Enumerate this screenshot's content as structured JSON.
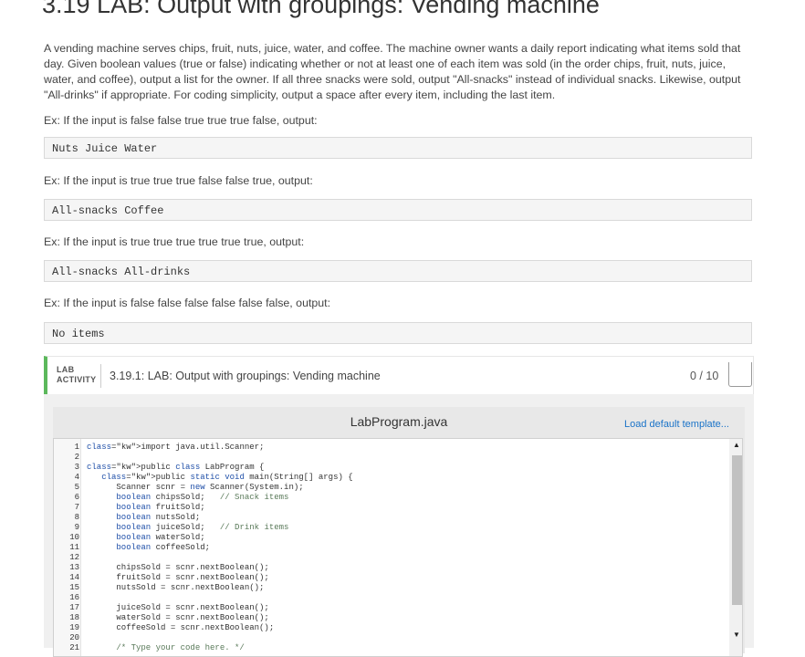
{
  "page": {
    "title": "3.19 LAB: Output with groupings: Vending machine",
    "description": "A vending machine serves chips, fruit, nuts, juice, water, and coffee. The machine owner wants a daily report indicating what items sold that day. Given boolean values (true or false) indicating whether or not at least one of each item was sold (in the order chips, fruit, nuts, juice, water, and coffee), output a list for the owner. If all three snacks were sold, output \"All-snacks\" instead of individual snacks. Likewise, output \"All-drinks\" if appropriate. For coding simplicity, output a space after every item, including the last item."
  },
  "examples": [
    {
      "label": "Ex: If the input is false false true true true false, output:",
      "output": "Nuts Juice Water"
    },
    {
      "label": "Ex: If the input is true true true false false true, output:",
      "output": "All-snacks Coffee"
    },
    {
      "label": "Ex: If the input is true true true true true true, output:",
      "output": "All-snacks All-drinks"
    },
    {
      "label": "Ex: If the input is false false false false false false, output:",
      "output": "No items"
    }
  ],
  "lab": {
    "tag_line1": "LAB",
    "tag_line2": "ACTIVITY",
    "title": "3.19.1: LAB: Output with groupings: Vending machine",
    "score": "0 / 10",
    "accent_color": "#5cb85c"
  },
  "editor": {
    "file_name": "LabProgram.java",
    "load_default": "Load default template...",
    "lines": [
      {
        "n": "1",
        "code": "import java.util.Scanner;"
      },
      {
        "n": "2",
        "code": ""
      },
      {
        "n": "3",
        "code": "public class LabProgram {"
      },
      {
        "n": "4",
        "code": "   public static void main(String[] args) {"
      },
      {
        "n": "5",
        "code": "      Scanner scnr = new Scanner(System.in);"
      },
      {
        "n": "6",
        "code": "      boolean chipsSold;   // Snack items"
      },
      {
        "n": "7",
        "code": "      boolean fruitSold;"
      },
      {
        "n": "8",
        "code": "      boolean nutsSold;"
      },
      {
        "n": "9",
        "code": "      boolean juiceSold;   // Drink items"
      },
      {
        "n": "10",
        "code": "      boolean waterSold;"
      },
      {
        "n": "11",
        "code": "      boolean coffeeSold;"
      },
      {
        "n": "12",
        "code": ""
      },
      {
        "n": "13",
        "code": "      chipsSold = scnr.nextBoolean();"
      },
      {
        "n": "14",
        "code": "      fruitSold = scnr.nextBoolean();"
      },
      {
        "n": "15",
        "code": "      nutsSold = scnr.nextBoolean();"
      },
      {
        "n": "16",
        "code": ""
      },
      {
        "n": "17",
        "code": "      juiceSold = scnr.nextBoolean();"
      },
      {
        "n": "18",
        "code": "      waterSold = scnr.nextBoolean();"
      },
      {
        "n": "19",
        "code": "      coffeeSold = scnr.nextBoolean();"
      },
      {
        "n": "20",
        "code": ""
      },
      {
        "n": "21",
        "code": "      /* Type your code here. */"
      }
    ]
  }
}
